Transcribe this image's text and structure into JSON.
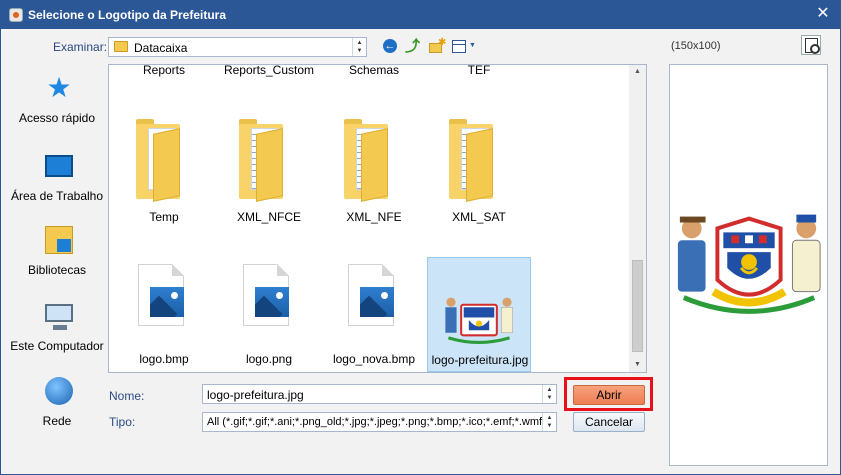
{
  "window": {
    "title": "Selecione o Logotipo da Prefeitura",
    "close_glyph": "✕"
  },
  "lookin": {
    "label": "Examinar:",
    "value": "Datacaixa"
  },
  "places": [
    {
      "label": "Acesso rápido",
      "icon": "quick-access-star-icon"
    },
    {
      "label": "Área de Trabalho",
      "icon": "desktop-icon"
    },
    {
      "label": "Bibliotecas",
      "icon": "libraries-icon"
    },
    {
      "label": "Este Computador",
      "icon": "computer-icon"
    },
    {
      "label": "Rede",
      "icon": "network-globe-icon"
    }
  ],
  "files": {
    "row_top": [
      "Reports",
      "Reports_Custom",
      "Schemas",
      "TEF"
    ],
    "folders": [
      "Temp",
      "XML_NFCE",
      "XML_NFE",
      "XML_SAT"
    ],
    "images": [
      "logo.bmp",
      "logo.png",
      "logo_nova.bmp",
      "logo-prefeitura.jpg"
    ],
    "selected": "logo-prefeitura.jpg"
  },
  "preview": {
    "size_label": "(150x100)"
  },
  "form": {
    "nome_label": "Nome:",
    "nome_value": "logo-prefeitura.jpg",
    "tipo_label": "Tipo:",
    "tipo_value": "All (*.gif;*.gif;*.ani;*.png_old;*.jpg;*.jpeg;*.png;*.bmp;*.ico;*.emf;*.wmf;*.t"
  },
  "buttons": {
    "open": "Abrir",
    "cancel": "Cancelar"
  },
  "colors": {
    "titlebar": "#2b5797",
    "open_button": "#ee7d52",
    "highlight": "#e8101a"
  }
}
